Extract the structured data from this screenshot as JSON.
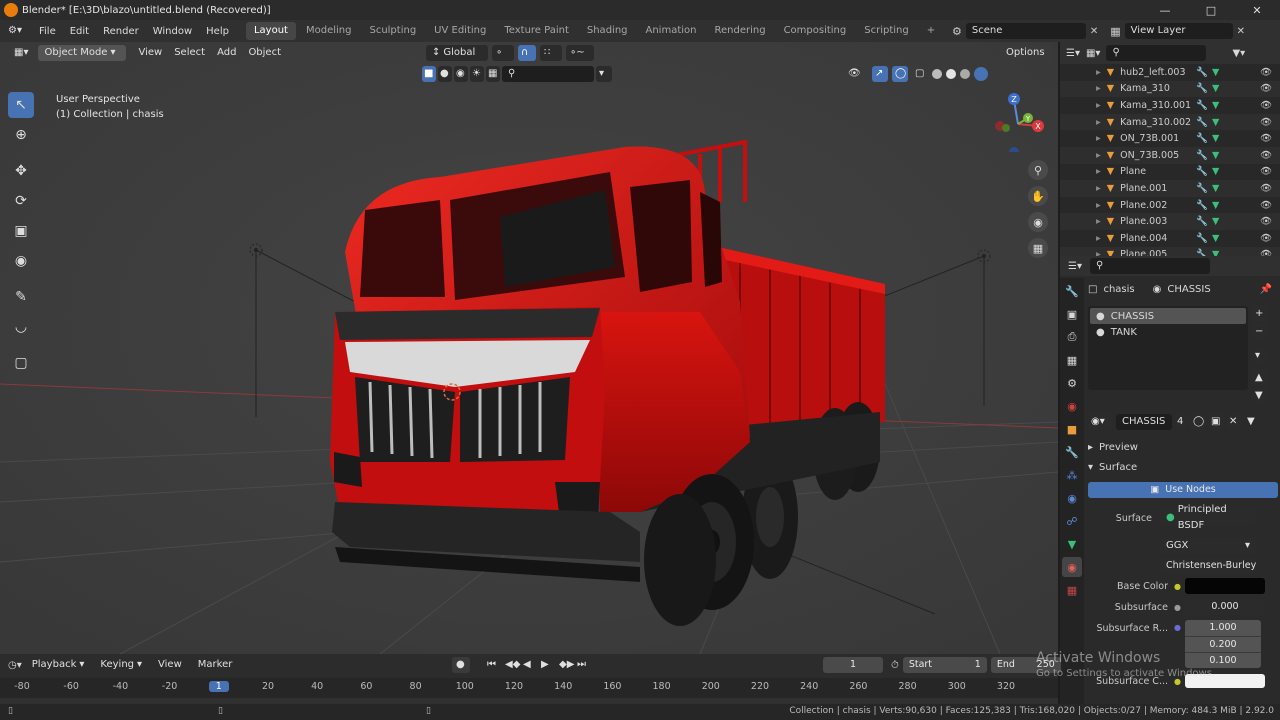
{
  "window": {
    "title": "Blender* [E:\\3D\\blazo\\untitled.blend (Recovered)]"
  },
  "menu": {
    "file": "File",
    "edit": "Edit",
    "render": "Render",
    "window": "Window",
    "help": "Help"
  },
  "workspaces": [
    "Layout",
    "Modeling",
    "Sculpting",
    "UV Editing",
    "Texture Paint",
    "Shading",
    "Animation",
    "Rendering",
    "Compositing",
    "Scripting"
  ],
  "scene": {
    "label": "Scene",
    "view_layer": "View Layer"
  },
  "viewport_header": {
    "mode": "Object Mode",
    "view": "View",
    "select": "Select",
    "add": "Add",
    "object": "Object",
    "orientation": "Global",
    "options": "Options"
  },
  "viewport_info": {
    "perspective": "User Perspective",
    "collection": "(1) Collection | chasis"
  },
  "gizmo": {
    "z": "Z",
    "y": "Y",
    "x": "X"
  },
  "outliner": {
    "items": [
      "hub2_left.003",
      "Kama_310",
      "Kama_310.001",
      "Kama_310.002",
      "ON_73B.001",
      "ON_73B.005",
      "Plane",
      "Plane.001",
      "Plane.002",
      "Plane.003",
      "Plane.004",
      "Plane.005"
    ]
  },
  "properties": {
    "object_name": "chasis",
    "material_name": "CHASSIS",
    "slots": [
      "CHASSIS",
      "TANK"
    ],
    "material_users": "4",
    "preview": "Preview",
    "surface_panel": "Surface",
    "use_nodes": "Use Nodes",
    "surface_label": "Surface",
    "surface_value": "Principled BSDF",
    "distribution": "GGX",
    "subsurface_method": "Christensen-Burley",
    "base_color_label": "Base Color",
    "subsurface_label": "Subsurface",
    "subsurface_value": "0.000",
    "subsurface_radius_label": "Subsurface R...",
    "subsurface_radius": [
      "1.000",
      "0.200",
      "0.100"
    ],
    "subsurface_color_label": "Subsurface C..."
  },
  "timeline": {
    "playback": "Playback",
    "keying": "Keying",
    "view": "View",
    "marker": "Marker",
    "current_frame": "1",
    "start_label": "Start",
    "start": "1",
    "end_label": "End",
    "end": "250",
    "ruler": [
      "-80",
      "-60",
      "-40",
      "-20",
      "1",
      "20",
      "40",
      "60",
      "80",
      "100",
      "120",
      "140",
      "160",
      "180",
      "200",
      "220",
      "240",
      "260",
      "280",
      "300",
      "320"
    ]
  },
  "status": {
    "text": "Collection | chasis | Verts:90,630 | Faces:125,383 | Tris:168,020 | Objects:0/27 | Memory: 484.3 MiB | 2.92.0"
  },
  "watermark": {
    "line1": "Activate Windows",
    "line2": "Go to Settings to activate Windows."
  },
  "colors": {
    "accent": "#4772b3",
    "truck_red": "#d10f10",
    "blender_orange": "#e87d0d"
  }
}
